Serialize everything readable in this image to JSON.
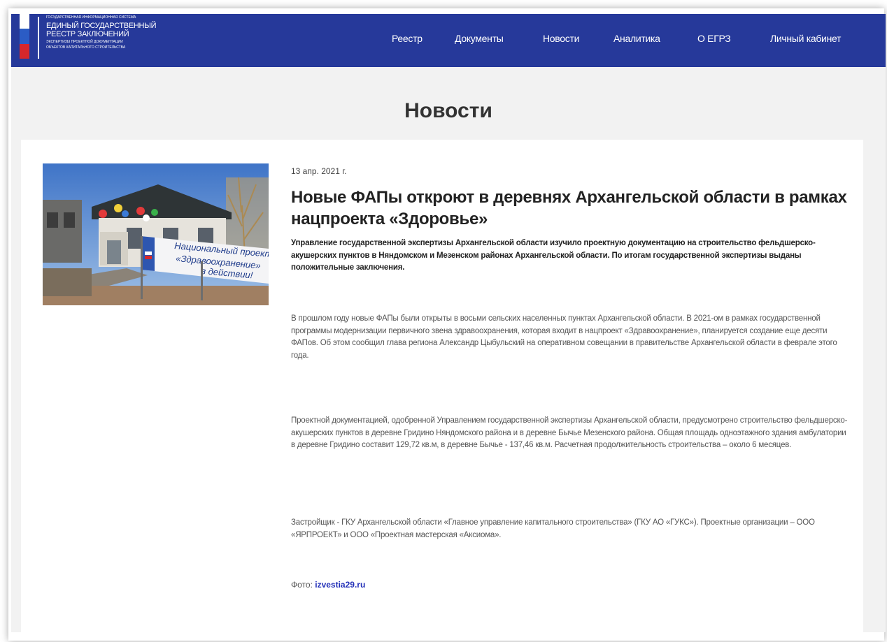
{
  "header": {
    "logo": {
      "top_line": "Государственная информационная система",
      "title_line1": "Единый государственный",
      "title_line2": "реестр заключений",
      "bottom_line1": "экспертизы проектной документации",
      "bottom_line2": "объектов капитального строительства"
    },
    "nav": [
      "Реестр",
      "Документы",
      "Новости",
      "Аналитика",
      "О ЕГРЗ",
      "Личный кабинет"
    ]
  },
  "page": {
    "title": "Новости"
  },
  "article": {
    "date": "13 апр. 2021 г.",
    "headline": "Новые ФАПы откроют в деревнях Архангельской области в рамках нацпроекта «Здоровье»",
    "lead": "Управление государственной экспертизы Архангельской области изучило проектную документацию на строительство фельдшерско-акушерских пунктов в Няндомском и Мезенском районах Архангельской области. По итогам государственной экспертизы выданы положительные заключения.",
    "paragraphs": [
      "В прошлом году новые ФАПы были открыты в восьми сельских населенных пунктах Архангельской области. В 2021-ом в рамках государственной программы модернизации первичного звена здравоохранения, которая входит в нацпроект «Здравоохранение», планируется создание еще десяти ФАПов. Об этом сообщил глава региона Александр Цыбульский на оперативном совещании в правительстве Архангельской области в феврале этого года.",
      "Проектной документацией, одобренной Управлением государственной экспертизы Архангельской области, предусмотрено строительство фельдшерско-акушерских пунктов в деревне Гридино Няндомского района и в деревне Бычье Мезенского района. Общая площадь одноэтажного здания амбулатории в деревне Гридино составит 129,72 кв.м, в деревне Бычье - 137,46 кв.м. Расчетная продолжительность строительства – около 6 месяцев.",
      "Застройщик - ГКУ Архангельской области «Главное управление капитального строительства» (ГКУ АО «ГУКС»). Проектные организации – ООО «ЯРПРОЕКТ» и ООО «Проектная мастерская «Аксиома»."
    ],
    "photo_label": "Фото:",
    "photo_link": "izvestia29.ru",
    "banner_text_line1": "Национальный проект",
    "banner_text_line2": "«Здравоохранение»",
    "banner_text_line3": "в действии!"
  },
  "colors": {
    "header_bg": "#26399a",
    "page_bg": "#f2f2f2",
    "link": "#2330b8"
  }
}
